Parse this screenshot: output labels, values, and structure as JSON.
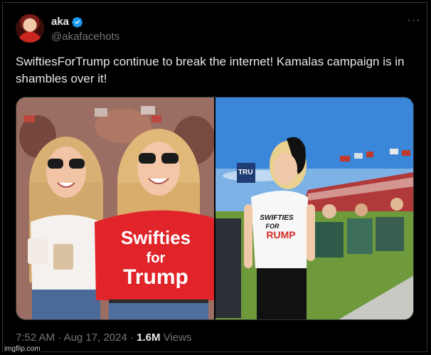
{
  "author": {
    "display_name": "aka",
    "handle": "@akafacehots",
    "verified": true
  },
  "tweet": {
    "text": "SwiftiesForTrump continue to break the internet! Kamalas campaign is in shambles over it!",
    "time": "7:52 AM",
    "separator": "·",
    "date": "Aug 17, 2024",
    "views_count": "1.6M",
    "views_label": "Views"
  },
  "media": {
    "left_photo": {
      "shirt_text_line1": "Swifties",
      "shirt_text_line2": "for",
      "shirt_text_line3": "Trump"
    },
    "right_photo": {
      "shirt_text_line1": "SWIFTIES",
      "shirt_text_line2": "FOR",
      "shirt_text_line3": "RUMP",
      "sign_text": "TRU"
    }
  },
  "watermark": "imgflip.com",
  "colors": {
    "background": "#000000",
    "text": "#e7e9ea",
    "muted": "#71767b",
    "verified": "#1d9bf0",
    "border": "#2f3336"
  },
  "icons": [
    "verified-badge-icon",
    "more-options-icon"
  ]
}
